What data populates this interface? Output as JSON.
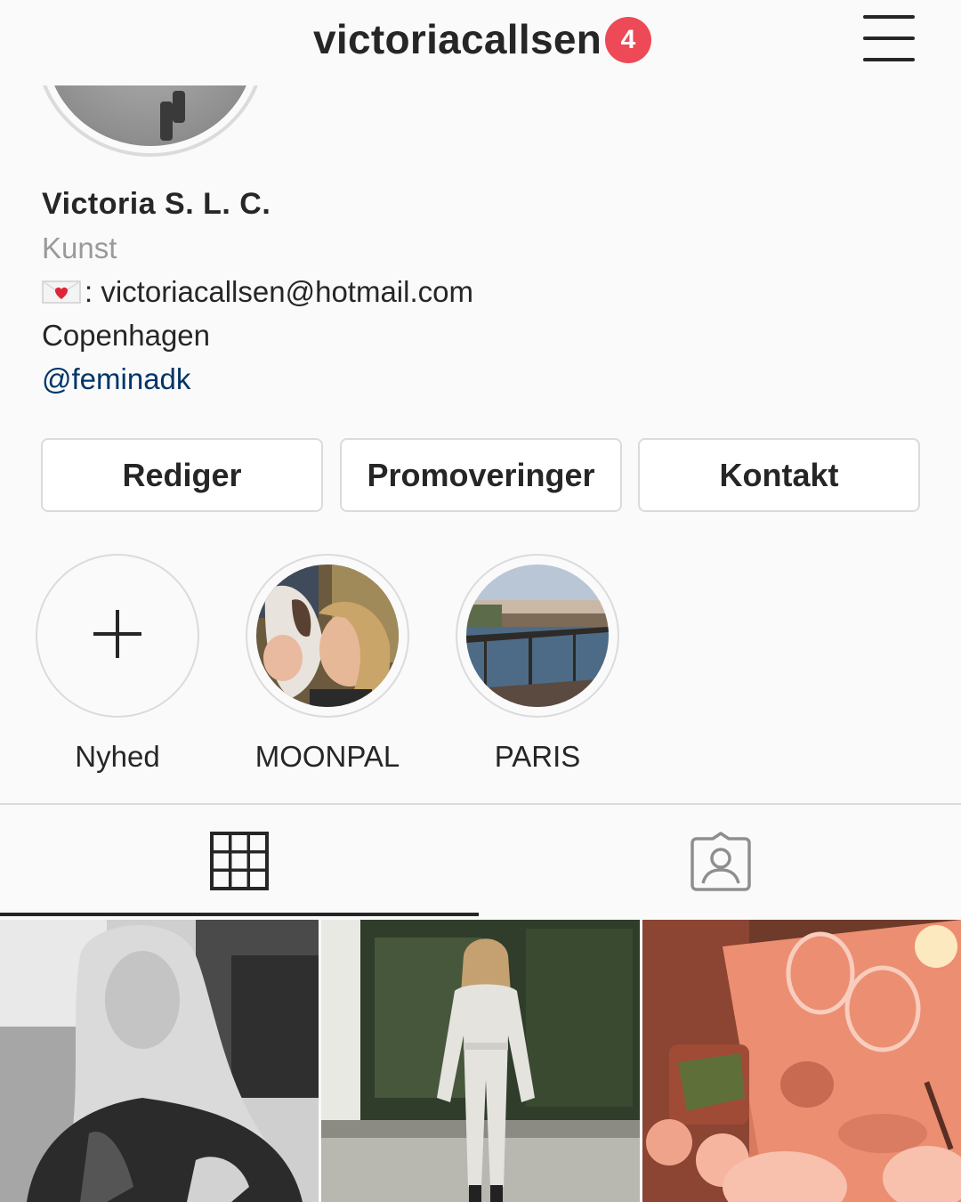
{
  "header": {
    "username": "victoriacallsen",
    "notification_count": "4"
  },
  "profile": {
    "display_name": "Victoria S. L. C.",
    "category": "Kunst",
    "email_line": ": victoriacallsen@hotmail.com",
    "city": "Copenhagen",
    "mention": "@feminadk"
  },
  "actions": {
    "edit_label": "Rediger",
    "promotions_label": "Promoveringer",
    "contact_label": "Kontakt"
  },
  "highlights": [
    {
      "label": "Nyhed"
    },
    {
      "label": "MOONPAL"
    },
    {
      "label": "PARIS"
    }
  ],
  "tabs": {
    "active": "grid",
    "items": [
      "grid-icon",
      "tagged-person-icon"
    ]
  },
  "posts": [
    {
      "description_icon": "photo-portrait-bw"
    },
    {
      "description_icon": "photo-jumpsuit"
    },
    {
      "description_icon": "photo-dinner-table"
    }
  ],
  "colors": {
    "badge": "#ed4956",
    "link": "#003569",
    "border": "#dbdbdb",
    "text": "#262626",
    "muted": "#9a9a9a"
  }
}
